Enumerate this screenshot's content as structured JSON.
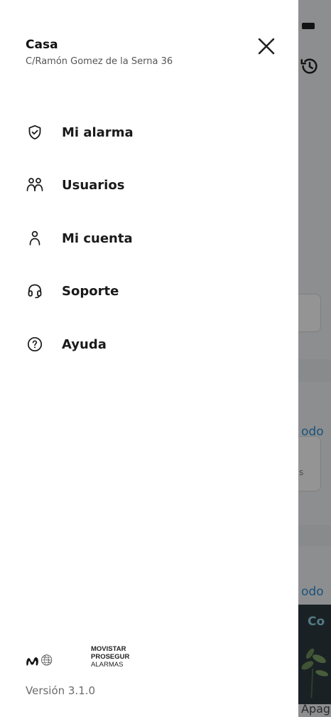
{
  "header": {
    "place_name": "Casa",
    "place_address": "C/Ramón Gomez de la Serna 36"
  },
  "menu": {
    "items": [
      {
        "label": "Mi alarma",
        "icon": "shield-check-icon"
      },
      {
        "label": "Usuarios",
        "icon": "users-icon"
      },
      {
        "label": "Mi cuenta",
        "icon": "user-icon"
      },
      {
        "label": "Soporte",
        "icon": "headset-icon"
      },
      {
        "label": "Ayuda",
        "icon": "help-circle-icon"
      }
    ]
  },
  "footer": {
    "logo_lines": [
      "MOVISTAR",
      "PROSEGUR",
      "ALARMAS"
    ],
    "version": "Versión 3.1.0"
  },
  "background": {
    "link_1": "odo",
    "link_2": "odo",
    "dark_band_text": "Co",
    "bottom_text": "Apag",
    "card_text": "s"
  },
  "colors": {
    "drawer_bg": "#ffffff",
    "overlay": "rgba(0,0,0,0.42)",
    "link_blue": "#2b8fd6",
    "text_primary": "#1a1a1a",
    "text_secondary": "#555555"
  }
}
